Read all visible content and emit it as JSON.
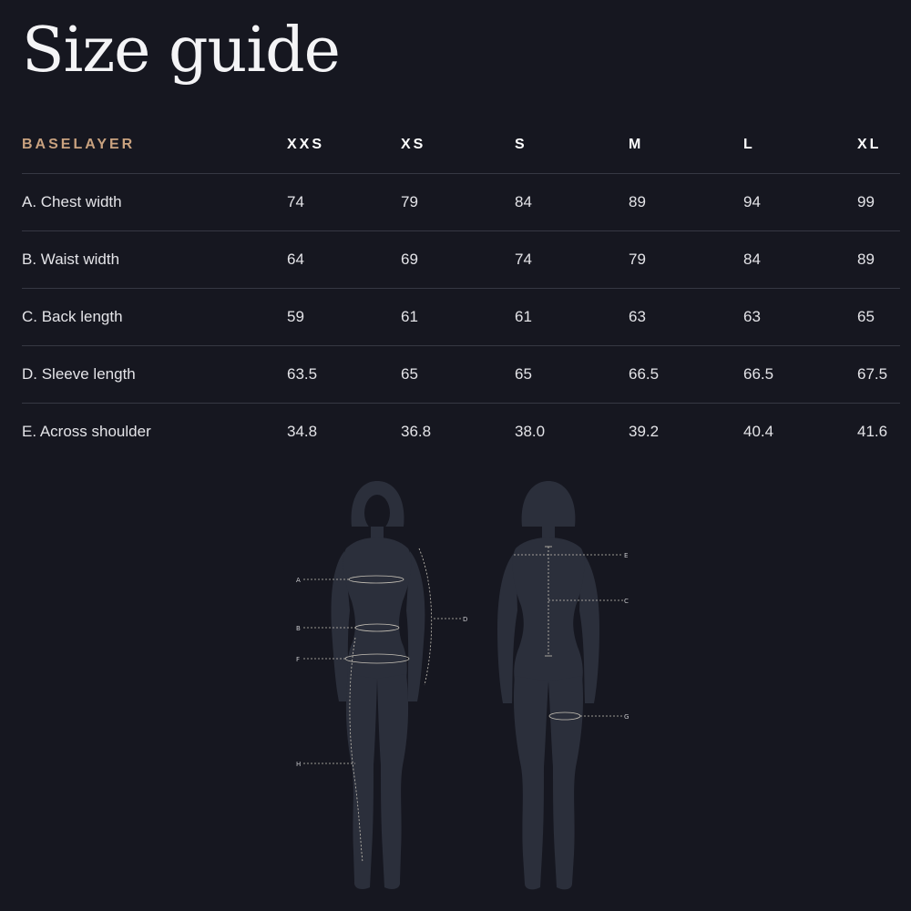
{
  "page": {
    "title": "Size guide"
  },
  "table": {
    "category": "BASELAYER",
    "sizes": [
      "XXS",
      "XS",
      "S",
      "M",
      "L",
      "XL"
    ],
    "rows": [
      {
        "label": "A. Chest width",
        "values": [
          "74",
          "79",
          "84",
          "89",
          "94",
          "99"
        ]
      },
      {
        "label": "B. Waist width",
        "values": [
          "64",
          "69",
          "74",
          "79",
          "84",
          "89"
        ]
      },
      {
        "label": "C. Back length",
        "values": [
          "59",
          "61",
          "61",
          "63",
          "63",
          "65"
        ]
      },
      {
        "label": "D. Sleeve length",
        "values": [
          "63.5",
          "65",
          "65",
          "66.5",
          "66.5",
          "67.5"
        ]
      },
      {
        "label": "E. Across shoulder",
        "values": [
          "34.8",
          "36.8",
          "38.0",
          "39.2",
          "40.4",
          "41.6"
        ]
      }
    ]
  },
  "diagram": {
    "front_labels": {
      "A": "A",
      "B": "B",
      "F": "F",
      "H": "H",
      "D": "D"
    },
    "back_labels": {
      "E": "E",
      "C": "C",
      "G": "G"
    }
  },
  "colors": {
    "background": "#161720",
    "accent": "#c9a27f",
    "text": "#e4e4e8",
    "divider": "#363843",
    "silhouette": "#2b2f3b",
    "measure_line": "#c8c3b8"
  }
}
